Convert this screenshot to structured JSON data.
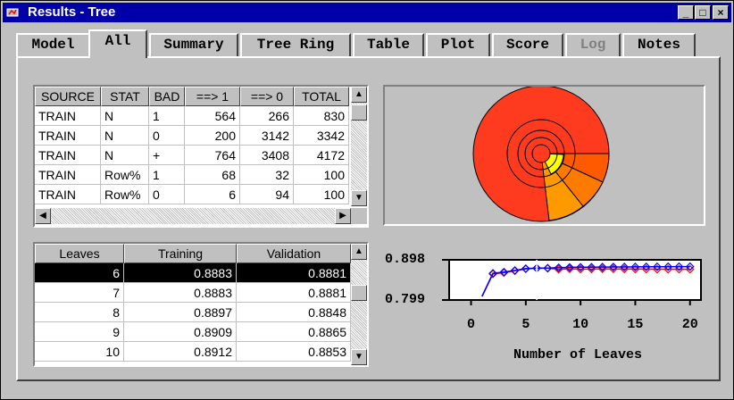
{
  "window": {
    "title": "Results - Tree",
    "minimize_label": "_",
    "maximize_label": "□",
    "close_label": "×"
  },
  "tabs": [
    {
      "label": "Model",
      "active": false,
      "disabled": false
    },
    {
      "label": "All",
      "active": true,
      "disabled": false
    },
    {
      "label": "Summary",
      "active": false,
      "disabled": false
    },
    {
      "label": "Tree Ring",
      "active": false,
      "disabled": false
    },
    {
      "label": "Table",
      "active": false,
      "disabled": false
    },
    {
      "label": "Plot",
      "active": false,
      "disabled": false
    },
    {
      "label": "Score",
      "active": false,
      "disabled": false
    },
    {
      "label": "Log",
      "active": false,
      "disabled": true
    },
    {
      "label": "Notes",
      "active": false,
      "disabled": false
    }
  ],
  "summary_table": {
    "columns": [
      "SOURCE",
      "STAT",
      "BAD",
      "==> 1",
      "==> 0",
      "TOTAL"
    ],
    "rows": [
      [
        "TRAIN",
        "N",
        "1",
        "564",
        "266",
        "830"
      ],
      [
        "TRAIN",
        "N",
        "0",
        "200",
        "3142",
        "3342"
      ],
      [
        "TRAIN",
        "N",
        "+",
        "764",
        "3408",
        "4172"
      ],
      [
        "TRAIN",
        "Row%",
        "1",
        "68",
        "32",
        "100"
      ],
      [
        "TRAIN",
        "Row%",
        "0",
        "6",
        "94",
        "100"
      ]
    ]
  },
  "leaves_table": {
    "columns": [
      "Leaves",
      "Training",
      "Validation"
    ],
    "rows": [
      [
        "6",
        "0.8883",
        "0.8881"
      ],
      [
        "7",
        "0.8883",
        "0.8881"
      ],
      [
        "8",
        "0.8897",
        "0.8848"
      ],
      [
        "9",
        "0.8909",
        "0.8865"
      ],
      [
        "10",
        "0.8912",
        "0.8853"
      ]
    ],
    "selected_row": 0
  },
  "tree_ring": {
    "colors": [
      "#ff3b1f",
      "#ff5a00",
      "#ff9900",
      "#ffb000",
      "#ffff00",
      "#ff7a00"
    ]
  },
  "chart_data": {
    "type": "line",
    "xlabel": "Number of Leaves",
    "ylabel": "",
    "xlim": [
      -2,
      21
    ],
    "ylim": [
      0.799,
      0.898
    ],
    "x_ticks": [
      "0",
      "5",
      "10",
      "15",
      "20"
    ],
    "y_ticks": [
      "0.898",
      "0.799"
    ],
    "selected_x": 6,
    "series": [
      {
        "color": "#0000ff",
        "marker": "diamond",
        "x": [
          1,
          2,
          3,
          4,
          5,
          6,
          7,
          8,
          9,
          10,
          11,
          12,
          13,
          14,
          15,
          16,
          17,
          18,
          19,
          20
        ],
        "y": [
          0.799,
          0.872,
          0.876,
          0.881,
          0.887,
          0.8883,
          0.8883,
          0.8897,
          0.8909,
          0.8912,
          0.8915,
          0.8918,
          0.892,
          0.8922,
          0.8924,
          0.8926,
          0.8928,
          0.893,
          0.8931,
          0.8932
        ]
      },
      {
        "color": "#ff0000",
        "marker": "diamond",
        "x": [
          1,
          2,
          3,
          4,
          5,
          6,
          7,
          8,
          9,
          10,
          11,
          12,
          13,
          14,
          15,
          16,
          17,
          18,
          19,
          20
        ],
        "y": [
          0.799,
          0.87,
          0.874,
          0.88,
          0.886,
          0.8881,
          0.8881,
          0.8848,
          0.8865,
          0.8853,
          0.8858,
          0.8862,
          0.886,
          0.8858,
          0.8855,
          0.8853,
          0.885,
          0.885,
          0.8849,
          0.8848
        ]
      }
    ]
  }
}
